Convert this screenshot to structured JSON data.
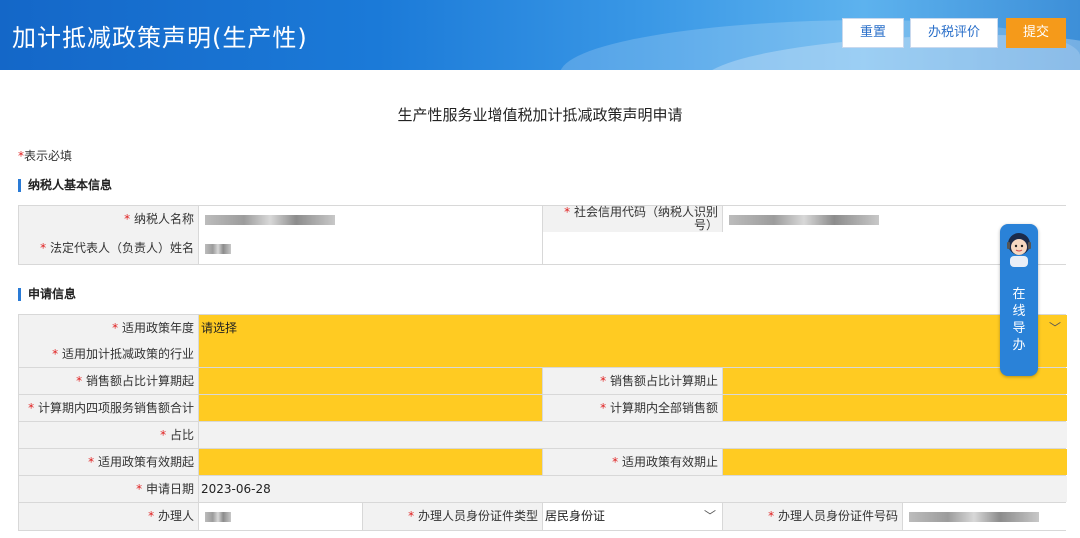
{
  "header": {
    "title": "加计抵减政策声明(生产性)",
    "buttons": {
      "reset": "重置",
      "evaluate": "办税评价",
      "submit": "提交"
    }
  },
  "form": {
    "title": "生产性服务业增值税加计抵减政策声明申请",
    "required_star": "*",
    "required_note": "表示必填"
  },
  "section_basic": {
    "heading": "纳税人基本信息",
    "taxpayer_name_label": "纳税人名称",
    "credit_code_label_1": "社会信用代码（纳税人识别",
    "credit_code_label_2": "号）",
    "legal_rep_label": "法定代表人（负责人）姓名"
  },
  "section_apply": {
    "heading": "申请信息",
    "policy_year_label": "适用政策年度",
    "policy_year_value": "请选择",
    "industry_label": "适用加计抵减政策的行业",
    "sales_start_label": "销售额占比计算期起",
    "sales_end_label": "销售额占比计算期止",
    "four_services_label": "计算期内四项服务销售额合计",
    "total_sales_label": "计算期内全部销售额",
    "ratio_label": "占比",
    "valid_start_label": "适用政策有效期起",
    "valid_end_label": "适用政策有效期止",
    "apply_date_label": "申请日期",
    "apply_date_value": "2023-06-28",
    "handler_label": "办理人",
    "id_type_label": "办理人员身份证件类型",
    "id_type_value": "居民身份证",
    "id_number_label": "办理人员身份证件号码"
  },
  "helper": {
    "text": "在线导办"
  },
  "colors": {
    "required_field": "#ffcb22",
    "accent": "#2a7bd6",
    "submit": "#f59a1a"
  }
}
